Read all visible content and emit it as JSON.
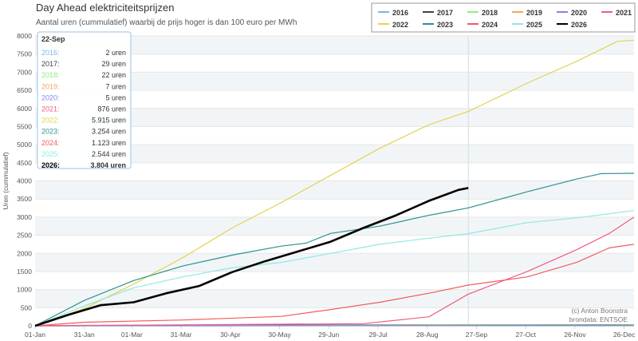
{
  "chart_data": {
    "type": "line",
    "title": "Day Ahead elektriciteitsprijzen",
    "subtitle": "Aantal uren (cummulatief) waarbij de prijs hoger is dan 100 euro per MWh",
    "ylabel": "Uren (cummulatief)",
    "xlabel": "",
    "ylim": [
      0,
      8000
    ],
    "yticks": [
      0,
      500,
      1000,
      1500,
      2000,
      2500,
      3000,
      3500,
      4000,
      4500,
      5000,
      5500,
      6000,
      6500,
      7000,
      7500,
      8000
    ],
    "xlim": [
      0,
      365
    ],
    "xticks": [
      {
        "day": 0,
        "label": "01-Jan"
      },
      {
        "day": 30,
        "label": "31-Jan"
      },
      {
        "day": 59,
        "label": "01-Mar"
      },
      {
        "day": 89,
        "label": "31-Mar"
      },
      {
        "day": 119,
        "label": "30-Apr"
      },
      {
        "day": 149,
        "label": "30-May"
      },
      {
        "day": 179,
        "label": "29-Jun"
      },
      {
        "day": 209,
        "label": "29-Jul"
      },
      {
        "day": 239,
        "label": "28-Aug"
      },
      {
        "day": 269,
        "label": "27-Sep"
      },
      {
        "day": 299,
        "label": "27-Oct"
      },
      {
        "day": 329,
        "label": "26-Nov"
      },
      {
        "day": 359,
        "label": "26-Dec"
      }
    ],
    "crosshair_day": 264,
    "grid": true,
    "legend_position": "top-right",
    "series": [
      {
        "name": "2016",
        "color": "#7cb5ec",
        "points": [
          [
            0,
            0
          ],
          [
            100,
            1
          ],
          [
            264,
            2
          ],
          [
            365,
            2
          ]
        ]
      },
      {
        "name": "2017",
        "color": "#434348",
        "points": [
          [
            0,
            0
          ],
          [
            30,
            10
          ],
          [
            100,
            20
          ],
          [
            264,
            29
          ],
          [
            365,
            30
          ]
        ]
      },
      {
        "name": "2018",
        "color": "#90ed7d",
        "points": [
          [
            0,
            0
          ],
          [
            150,
            10
          ],
          [
            264,
            22
          ],
          [
            365,
            25
          ]
        ]
      },
      {
        "name": "2019",
        "color": "#f7a35c",
        "points": [
          [
            0,
            0
          ],
          [
            100,
            3
          ],
          [
            264,
            7
          ],
          [
            365,
            8
          ]
        ]
      },
      {
        "name": "2020",
        "color": "#8085e9",
        "points": [
          [
            0,
            0
          ],
          [
            100,
            2
          ],
          [
            264,
            5
          ],
          [
            365,
            6
          ]
        ]
      },
      {
        "name": "2021",
        "color": "#f15c80",
        "points": [
          [
            0,
            0
          ],
          [
            200,
            60
          ],
          [
            240,
            250
          ],
          [
            264,
            876
          ],
          [
            300,
            1500
          ],
          [
            330,
            2100
          ],
          [
            350,
            2550
          ],
          [
            365,
            3000
          ]
        ]
      },
      {
        "name": "2022",
        "color": "#e4d354",
        "points": [
          [
            0,
            0
          ],
          [
            30,
            480
          ],
          [
            60,
            1150
          ],
          [
            90,
            1880
          ],
          [
            120,
            2700
          ],
          [
            150,
            3400
          ],
          [
            180,
            4150
          ],
          [
            210,
            4900
          ],
          [
            240,
            5550
          ],
          [
            264,
            5915
          ],
          [
            300,
            6700
          ],
          [
            330,
            7300
          ],
          [
            355,
            7850
          ],
          [
            365,
            7880
          ]
        ]
      },
      {
        "name": "2023",
        "color": "#2b908f",
        "points": [
          [
            0,
            0
          ],
          [
            30,
            700
          ],
          [
            60,
            1250
          ],
          [
            90,
            1650
          ],
          [
            120,
            1950
          ],
          [
            150,
            2200
          ],
          [
            165,
            2280
          ],
          [
            180,
            2550
          ],
          [
            210,
            2750
          ],
          [
            240,
            3050
          ],
          [
            264,
            3254
          ],
          [
            300,
            3700
          ],
          [
            330,
            4050
          ],
          [
            345,
            4200
          ],
          [
            365,
            4210
          ]
        ]
      },
      {
        "name": "2024",
        "color": "#f45b5b",
        "points": [
          [
            0,
            0
          ],
          [
            30,
            100
          ],
          [
            90,
            160
          ],
          [
            150,
            260
          ],
          [
            180,
            450
          ],
          [
            210,
            650
          ],
          [
            240,
            900
          ],
          [
            264,
            1123
          ],
          [
            300,
            1350
          ],
          [
            330,
            1750
          ],
          [
            350,
            2150
          ],
          [
            365,
            2250
          ]
        ]
      },
      {
        "name": "2025",
        "color": "#91e8e1",
        "points": [
          [
            0,
            0
          ],
          [
            30,
            550
          ],
          [
            60,
            1050
          ],
          [
            90,
            1350
          ],
          [
            120,
            1600
          ],
          [
            150,
            1750
          ],
          [
            180,
            2000
          ],
          [
            210,
            2250
          ],
          [
            240,
            2420
          ],
          [
            264,
            2544
          ],
          [
            300,
            2850
          ],
          [
            330,
            2980
          ],
          [
            365,
            3180
          ]
        ]
      },
      {
        "name": "2026",
        "color": "#000000",
        "points": [
          [
            0,
            0
          ],
          [
            20,
            300
          ],
          [
            40,
            570
          ],
          [
            60,
            650
          ],
          [
            80,
            900
          ],
          [
            100,
            1100
          ],
          [
            120,
            1480
          ],
          [
            140,
            1780
          ],
          [
            160,
            2050
          ],
          [
            180,
            2320
          ],
          [
            200,
            2700
          ],
          [
            220,
            3050
          ],
          [
            240,
            3450
          ],
          [
            258,
            3750
          ],
          [
            264,
            3804
          ]
        ]
      }
    ],
    "tooltip": {
      "date": "22-Sep",
      "rows": [
        {
          "year": "2016:",
          "value": "2 uren",
          "color": "#7cb5ec"
        },
        {
          "year": "2017:",
          "value": "29 uren",
          "color": "#434348"
        },
        {
          "year": "2018:",
          "value": "22 uren",
          "color": "#90ed7d"
        },
        {
          "year": "2019:",
          "value": "7 uren",
          "color": "#f7a35c"
        },
        {
          "year": "2020:",
          "value": "5 uren",
          "color": "#8085e9"
        },
        {
          "year": "2021:",
          "value": "876 uren",
          "color": "#f15c80"
        },
        {
          "year": "2022:",
          "value": "5.915 uren",
          "color": "#e4d354"
        },
        {
          "year": "2023:",
          "value": "3.254 uren",
          "color": "#2b908f"
        },
        {
          "year": "2024:",
          "value": "1.123 uren",
          "color": "#f45b5b"
        },
        {
          "year": "2025:",
          "value": "2.544 uren",
          "color": "#91e8e1"
        },
        {
          "year": "2026:",
          "value": "3.804 uren",
          "color": "#000000"
        }
      ]
    },
    "credits": [
      "(c) Anton Boonstra",
      "brondata: ENTSOE"
    ]
  }
}
